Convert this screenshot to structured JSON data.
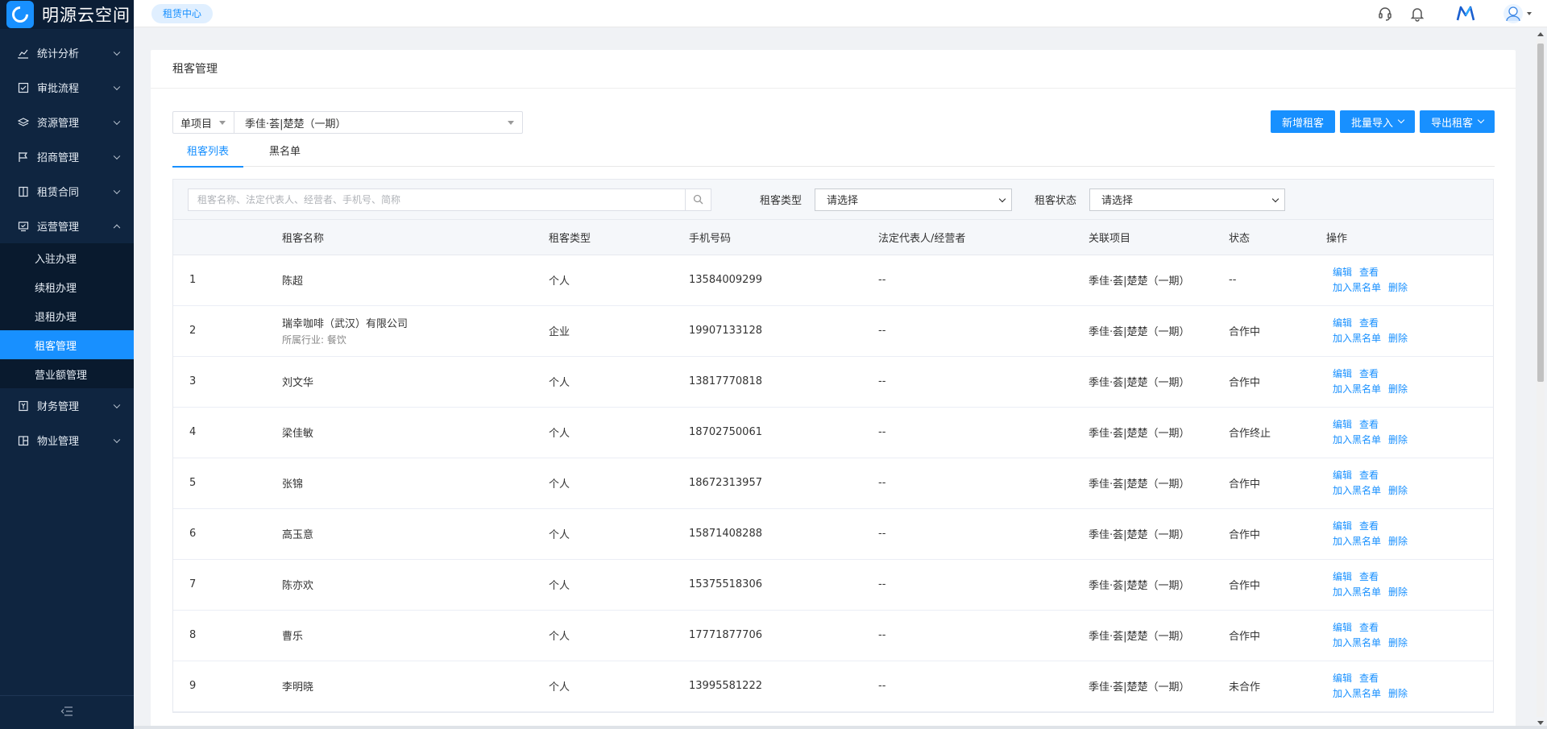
{
  "app": {
    "name": "明源云空间"
  },
  "sidebar": {
    "items": [
      {
        "label": "统计分析",
        "icon": "chart-line-icon"
      },
      {
        "label": "审批流程",
        "icon": "checklist-icon"
      },
      {
        "label": "资源管理",
        "icon": "layers-icon"
      },
      {
        "label": "招商管理",
        "icon": "flag-icon"
      },
      {
        "label": "租赁合同",
        "icon": "contract-icon"
      },
      {
        "label": "运营管理",
        "icon": "monitor-check-icon"
      },
      {
        "label": "财务管理",
        "icon": "finance-icon"
      },
      {
        "label": "物业管理",
        "icon": "building-icon"
      }
    ],
    "ops_sub": [
      "入驻办理",
      "续租办理",
      "退租办理",
      "租客管理",
      "营业额管理"
    ]
  },
  "topbar": {
    "chip": "租赁中心"
  },
  "page": {
    "title": "租客管理"
  },
  "project": {
    "type": "单项目",
    "name": "季佳·荟|楚楚（一期）"
  },
  "buttons": {
    "add": "新增租客",
    "import": "批量导入",
    "export": "导出租客"
  },
  "tabs": [
    "租客列表",
    "黑名单"
  ],
  "filters": {
    "search_placeholder": "租客名称、法定代表人、经营者、手机号、简称",
    "type_label": "租客类型",
    "type_value": "请选择",
    "status_label": "租客状态",
    "status_value": "请选择"
  },
  "table": {
    "columns": [
      "",
      "租客名称",
      "租客类型",
      "手机号码",
      "法定代表人/经营者",
      "关联项目",
      "状态",
      "操作"
    ],
    "actions": {
      "edit": "编辑",
      "view": "查看",
      "blacklist": "加入黑名单",
      "delete": "删除"
    },
    "rows": [
      {
        "idx": "1",
        "name": "陈超",
        "sub": "",
        "type": "个人",
        "phone": "13584009299",
        "rep": "--",
        "project": "季佳·荟|楚楚（一期）",
        "status": "--"
      },
      {
        "idx": "2",
        "name": "瑞幸咖啡（武汉）有限公司",
        "sub": "所属行业: 餐饮",
        "type": "企业",
        "phone": "19907133128",
        "rep": "--",
        "project": "季佳·荟|楚楚（一期）",
        "status": "合作中"
      },
      {
        "idx": "3",
        "name": "刘文华",
        "sub": "",
        "type": "个人",
        "phone": "13817770818",
        "rep": "--",
        "project": "季佳·荟|楚楚（一期）",
        "status": "合作中"
      },
      {
        "idx": "4",
        "name": "梁佳敏",
        "sub": "",
        "type": "个人",
        "phone": "18702750061",
        "rep": "--",
        "project": "季佳·荟|楚楚（一期）",
        "status": "合作终止"
      },
      {
        "idx": "5",
        "name": "张锦",
        "sub": "",
        "type": "个人",
        "phone": "18672313957",
        "rep": "--",
        "project": "季佳·荟|楚楚（一期）",
        "status": "合作中"
      },
      {
        "idx": "6",
        "name": "高玉意",
        "sub": "",
        "type": "个人",
        "phone": "15871408288",
        "rep": "--",
        "project": "季佳·荟|楚楚（一期）",
        "status": "合作中"
      },
      {
        "idx": "7",
        "name": "陈亦欢",
        "sub": "",
        "type": "个人",
        "phone": "15375518306",
        "rep": "--",
        "project": "季佳·荟|楚楚（一期）",
        "status": "合作中"
      },
      {
        "idx": "8",
        "name": "曹乐",
        "sub": "",
        "type": "个人",
        "phone": "17771877706",
        "rep": "--",
        "project": "季佳·荟|楚楚（一期）",
        "status": "合作中"
      },
      {
        "idx": "9",
        "name": "李明晓",
        "sub": "",
        "type": "个人",
        "phone": "13995581222",
        "rep": "--",
        "project": "季佳·荟|楚楚（一期）",
        "status": "未合作"
      }
    ]
  },
  "colors": {
    "primary": "#1890ff",
    "sidebar": "#0f2540",
    "sidebar_active": "#1890ff"
  }
}
